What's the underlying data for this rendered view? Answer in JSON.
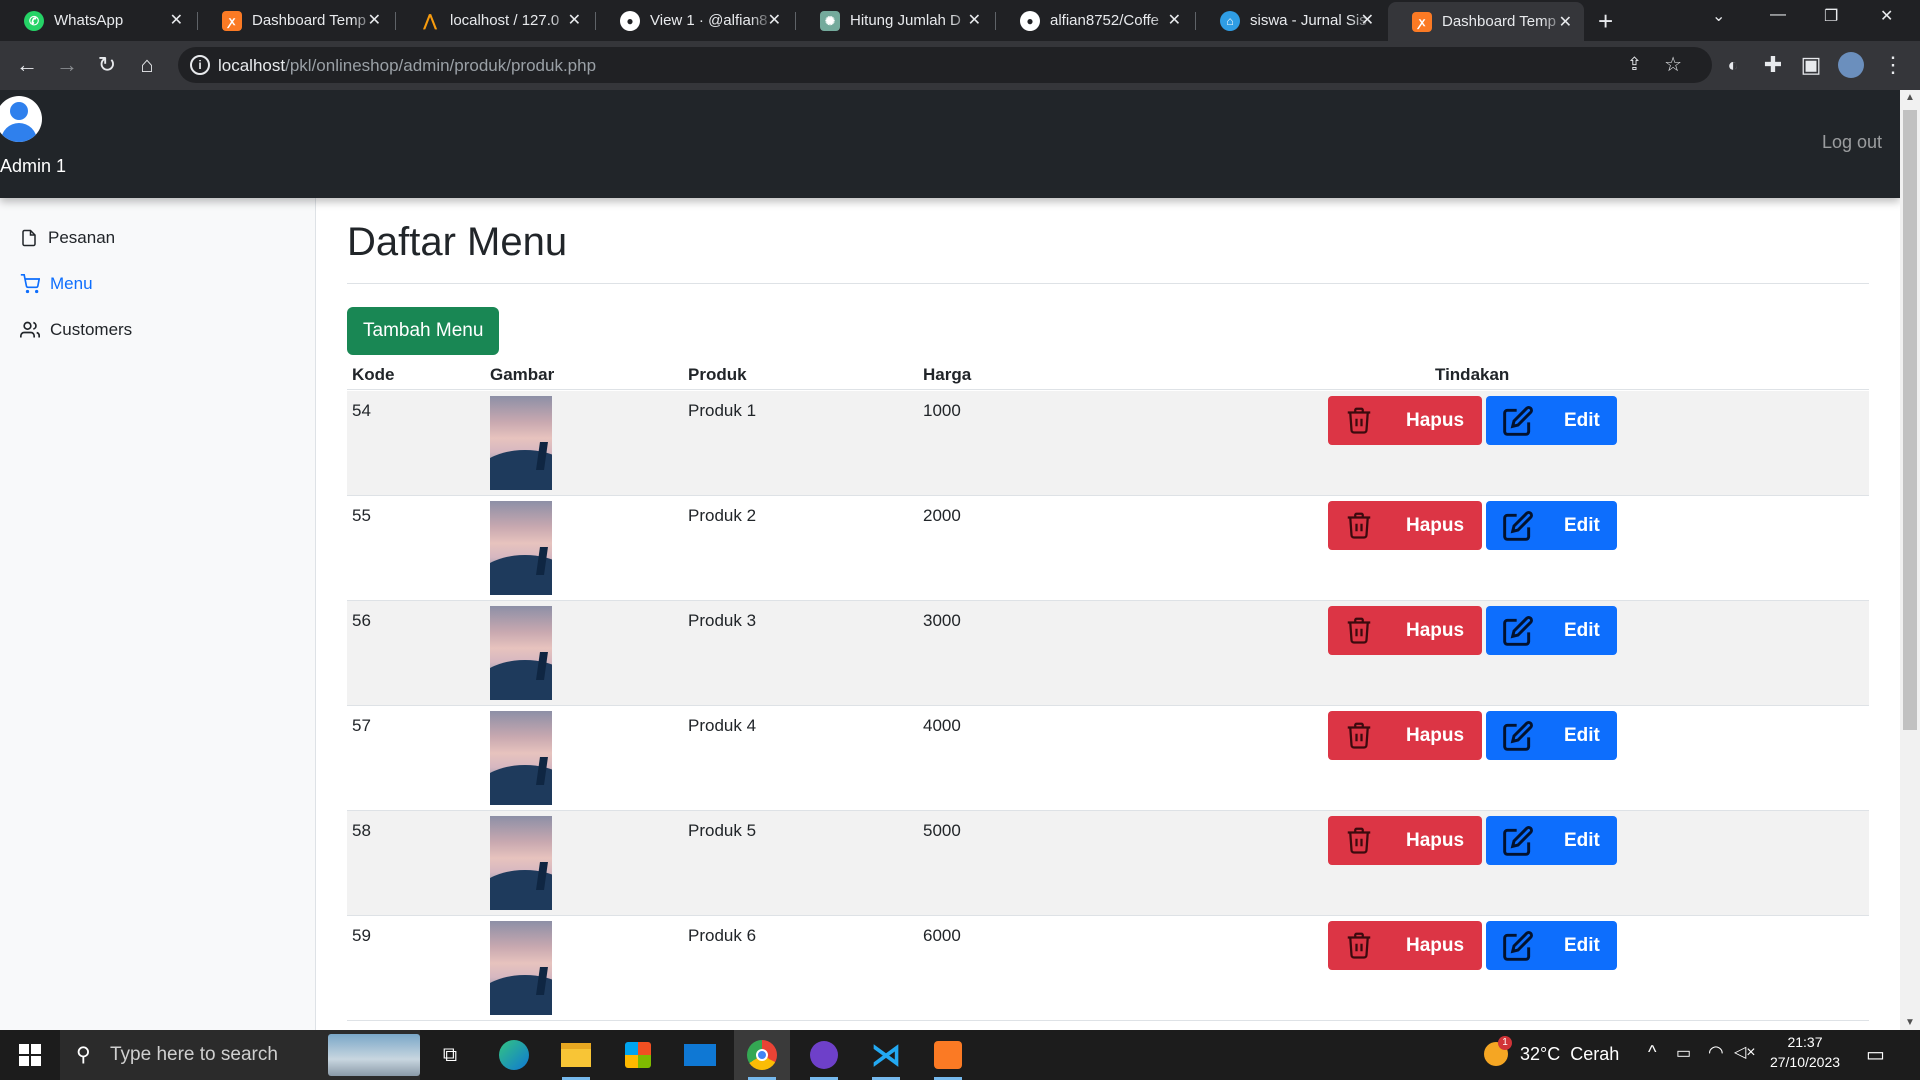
{
  "browser": {
    "tabs": [
      {
        "title": "WhatsApp",
        "icon": "whatsapp-icon",
        "color": "#25d366"
      },
      {
        "title": "Dashboard Temp",
        "icon": "xampp-icon",
        "color": "#fb7a24"
      },
      {
        "title": "localhost / 127.0",
        "icon": "phpmyadmin-icon",
        "color": "#f89c0e"
      },
      {
        "title": "View 1 · @alfian8",
        "icon": "github-icon",
        "color": "#ffffff"
      },
      {
        "title": "Hitung Jumlah D",
        "icon": "chatgpt-icon",
        "color": "#74aa9c"
      },
      {
        "title": "alfian8752/Coffe",
        "icon": "github-icon",
        "color": "#ffffff"
      },
      {
        "title": "siswa - Jurnal Sis",
        "icon": "school-icon",
        "color": "#2f9de4"
      },
      {
        "title": "Dashboard Temp",
        "icon": "xampp-icon",
        "color": "#fb7a24",
        "active": true
      }
    ],
    "url_host": "localhost",
    "url_path": "/pkl/onlineshop/admin/produk/produk.php"
  },
  "navbar": {
    "user_name": "Admin 1",
    "logout_label": "Log out"
  },
  "sidebar": {
    "items": [
      {
        "label": "Pesanan",
        "icon": "file-icon"
      },
      {
        "label": "Menu",
        "icon": "cart-icon",
        "active": true
      },
      {
        "label": "Customers",
        "icon": "users-icon"
      }
    ]
  },
  "main": {
    "title": "Daftar Menu",
    "add_button": "Tambah Menu",
    "columns": [
      "Kode",
      "Gambar",
      "Produk",
      "Harga",
      "Tindakan"
    ],
    "rows": [
      {
        "kode": "54",
        "produk": "Produk 1",
        "harga": "1000"
      },
      {
        "kode": "55",
        "produk": "Produk 2",
        "harga": "2000"
      },
      {
        "kode": "56",
        "produk": "Produk 3",
        "harga": "3000"
      },
      {
        "kode": "57",
        "produk": "Produk 4",
        "harga": "4000"
      },
      {
        "kode": "58",
        "produk": "Produk 5",
        "harga": "5000"
      },
      {
        "kode": "59",
        "produk": "Produk 6",
        "harga": "6000"
      }
    ],
    "delete_label": "Hapus",
    "edit_label": "Edit"
  },
  "taskbar": {
    "search_placeholder": "Type here to search",
    "weather": "32°C  Cerah",
    "time": "21:37",
    "date": "27/10/2023",
    "weather_badge": "1"
  },
  "colors": {
    "success": "#198754",
    "danger": "#dc3545",
    "primary": "#0d6efd",
    "navbar": "#212529"
  }
}
